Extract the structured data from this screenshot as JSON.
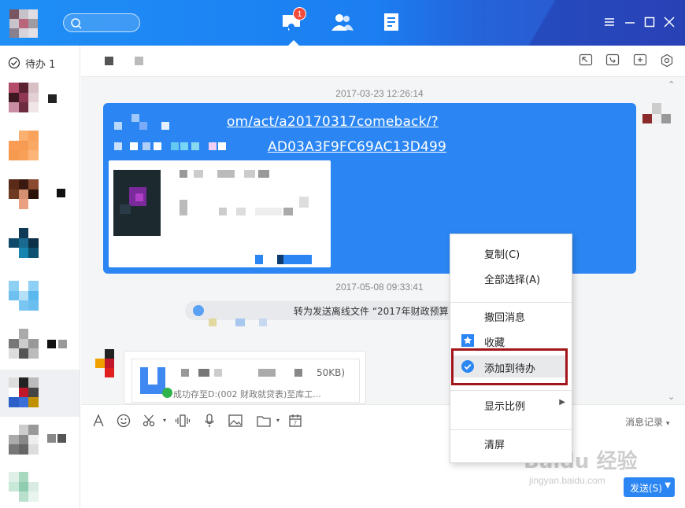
{
  "topbar": {
    "badge_count": "1",
    "colors": {
      "bar": "#1b7ef2",
      "badge": "#f24b3c"
    }
  },
  "sidebar": {
    "todo_label": "待办 1"
  },
  "chat": {
    "timestamp_1": "2017-03-23 12:26:14",
    "link_line_1": "om/act/a20170317comeback/?",
    "link_line_2": "AD03A3F9FC69AC13D499",
    "timestamp_2": "2017-05-08 09:33:41",
    "notice_text": "转为发送离线文件 “2017年财政预算",
    "file_size": "50KB)",
    "file_path": "成功存至D:(002 财政就贷表)至库工..."
  },
  "context_menu": {
    "copy": "复制(C)",
    "select_all": "全部选择(A)",
    "recall": "撤回消息",
    "favorite": "收藏",
    "add_todo": "添加到待办",
    "zoom": "显示比例",
    "clear": "清屏"
  },
  "toolbar": {
    "history_label": "消息记录"
  },
  "send": {
    "label": "发送(S)"
  },
  "watermark": {
    "line1": "Baidu 经验",
    "line2": "jingyan.baidu.com"
  },
  "icons": [
    "search-icon",
    "chat-nav-icon",
    "contacts-nav-icon",
    "docs-nav-icon",
    "minimize-icon",
    "maximize-icon",
    "close-icon",
    "check-circle-icon",
    "font-icon",
    "emoji-icon",
    "scissors-icon",
    "shake-icon",
    "mic-icon",
    "image-icon",
    "folder-icon",
    "calendar-icon",
    "star-icon",
    "check-badge-icon"
  ]
}
